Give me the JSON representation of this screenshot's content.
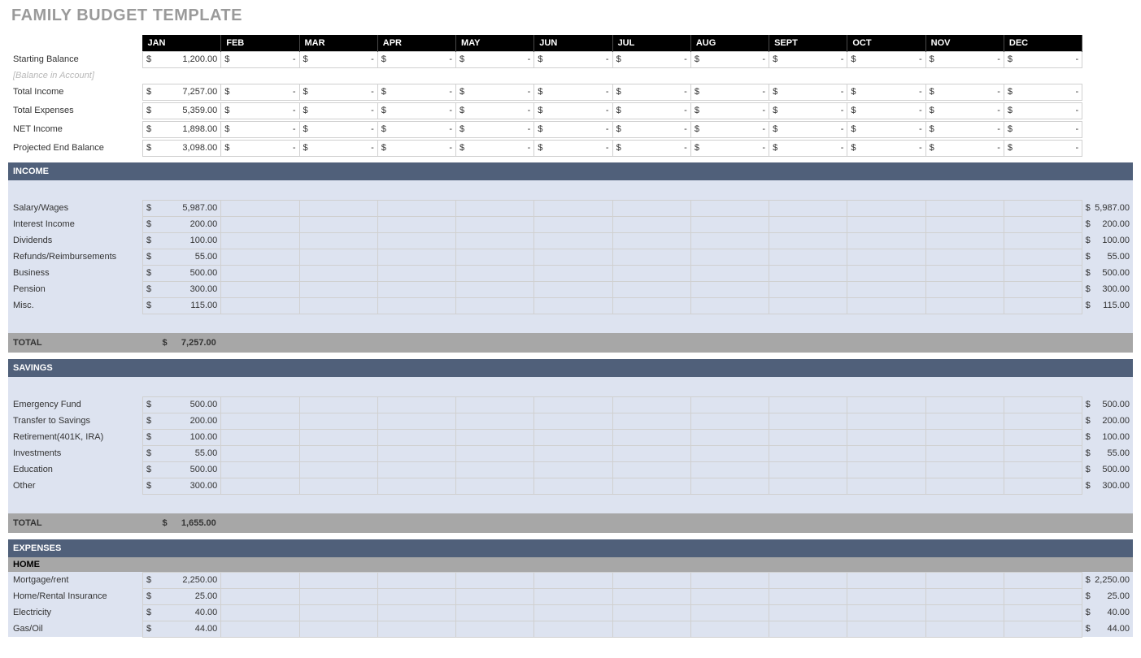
{
  "title": "FAMILY BUDGET TEMPLATE",
  "months": [
    "JAN",
    "FEB",
    "MAR",
    "APR",
    "MAY",
    "JUN",
    "JUL",
    "AUG",
    "SEPT",
    "OCT",
    "NOV",
    "DEC"
  ],
  "summary": {
    "starting_balance_label": "Starting Balance",
    "starting_balance_sub": "[Balance in Account]",
    "total_income_label": "Total Income",
    "total_expenses_label": "Total Expenses",
    "net_income_label": "NET Income",
    "projected_end_label": "Projected End Balance",
    "rows": {
      "starting_balance": [
        "1,200.00",
        "-",
        "-",
        "-",
        "-",
        "-",
        "-",
        "-",
        "-",
        "-",
        "-",
        "-"
      ],
      "total_income": [
        "7,257.00",
        "-",
        "-",
        "-",
        "-",
        "-",
        "-",
        "-",
        "-",
        "-",
        "-",
        "-"
      ],
      "total_expenses": [
        "5,359.00",
        "-",
        "-",
        "-",
        "-",
        "-",
        "-",
        "-",
        "-",
        "-",
        "-",
        "-"
      ],
      "net_income": [
        "1,898.00",
        "-",
        "-",
        "-",
        "-",
        "-",
        "-",
        "-",
        "-",
        "-",
        "-",
        "-"
      ],
      "projected_end": [
        "3,098.00",
        "-",
        "-",
        "-",
        "-",
        "-",
        "-",
        "-",
        "-",
        "-",
        "-",
        "-"
      ]
    }
  },
  "income": {
    "header": "INCOME",
    "total_label": "TOTAL",
    "total_value": "7,257.00",
    "items": [
      {
        "label": "Salary/Wages",
        "jan": "5,987.00",
        "total": "5,987.00"
      },
      {
        "label": "Interest Income",
        "jan": "200.00",
        "total": "200.00"
      },
      {
        "label": "Dividends",
        "jan": "100.00",
        "total": "100.00"
      },
      {
        "label": "Refunds/Reimbursements",
        "jan": "55.00",
        "total": "55.00"
      },
      {
        "label": "Business",
        "jan": "500.00",
        "total": "500.00"
      },
      {
        "label": "Pension",
        "jan": "300.00",
        "total": "300.00"
      },
      {
        "label": "Misc.",
        "jan": "115.00",
        "total": "115.00"
      }
    ]
  },
  "savings": {
    "header": "SAVINGS",
    "total_label": "TOTAL",
    "total_value": "1,655.00",
    "items": [
      {
        "label": "Emergency Fund",
        "jan": "500.00",
        "total": "500.00"
      },
      {
        "label": "Transfer to Savings",
        "jan": "200.00",
        "total": "200.00"
      },
      {
        "label": "Retirement(401K, IRA)",
        "jan": "100.00",
        "total": "100.00"
      },
      {
        "label": "Investments",
        "jan": "55.00",
        "total": "55.00"
      },
      {
        "label": "Education",
        "jan": "500.00",
        "total": "500.00"
      },
      {
        "label": "Other",
        "jan": "300.00",
        "total": "300.00"
      }
    ]
  },
  "expenses": {
    "header": "EXPENSES",
    "home_header": "HOME",
    "items": [
      {
        "label": "Mortgage/rent",
        "jan": "2,250.00",
        "total": "2,250.00"
      },
      {
        "label": "Home/Rental Insurance",
        "jan": "25.00",
        "total": "25.00"
      },
      {
        "label": "Electricity",
        "jan": "40.00",
        "total": "40.00"
      },
      {
        "label": "Gas/Oil",
        "jan": "44.00",
        "total": "44.00"
      }
    ]
  },
  "currency": "$"
}
